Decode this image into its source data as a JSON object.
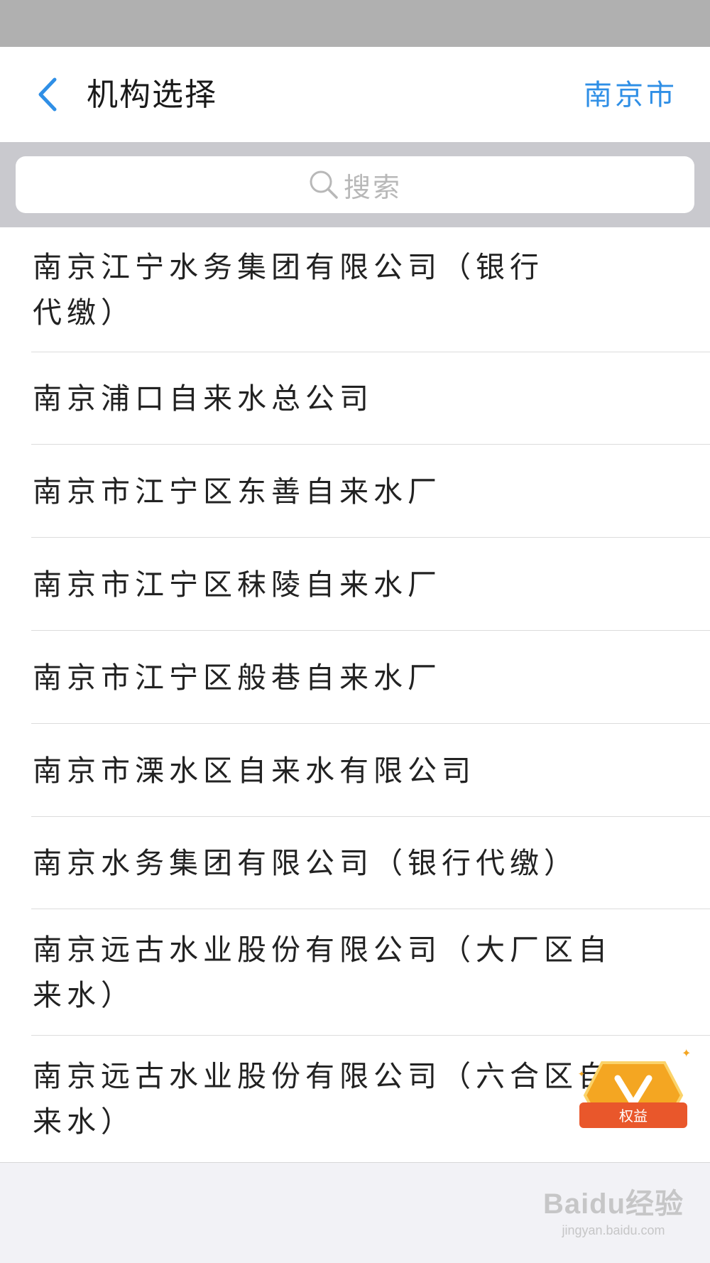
{
  "header": {
    "back_icon": "chevron-left-icon",
    "title": "机构选择",
    "city": "南京市"
  },
  "search": {
    "icon": "search-icon",
    "placeholder": "搜索"
  },
  "institutions": [
    {
      "name": "南京江宁水务集团有限公司（银行代缴）"
    },
    {
      "name": "南京浦口自来水总公司"
    },
    {
      "name": "南京市江宁区东善自来水厂"
    },
    {
      "name": "南京市江宁区秣陵自来水厂"
    },
    {
      "name": "南京市江宁区般巷自来水厂"
    },
    {
      "name": "南京市溧水区自来水有限公司"
    },
    {
      "name": "南京水务集团有限公司（银行代缴）"
    },
    {
      "name": "南京远古水业股份有限公司（大厂区自来水）"
    },
    {
      "name": "南京远古水业股份有限公司（六合区自来水）"
    }
  ],
  "badge": {
    "icon": "v-badge-icon",
    "label": "权益"
  },
  "watermark": {
    "logo": "Baidu经验",
    "url": "jingyan.baidu.com"
  },
  "colors": {
    "accent": "#2f8fe6",
    "status_bar": "#b0b0b0",
    "search_bg": "#c9c9ce",
    "badge_orange": "#f4a622",
    "badge_red": "#e9572b"
  }
}
